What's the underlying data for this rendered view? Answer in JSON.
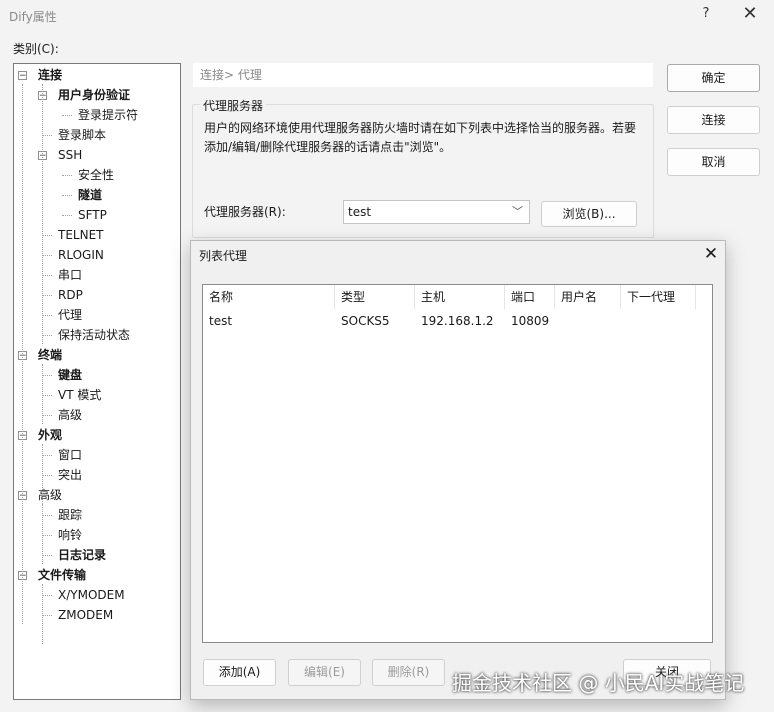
{
  "window": {
    "title": "Dify属性",
    "help_label": "?",
    "close_label": "✕"
  },
  "category_label": "类别(C):",
  "tree": [
    {
      "label": "连接",
      "bold": true,
      "toggle": "−"
    },
    {
      "label": "用户身份验证",
      "bold": true,
      "toggle": "−"
    },
    {
      "label": "登录提示符",
      "bold": false
    },
    {
      "label": "登录脚本",
      "bold": false
    },
    {
      "label": "SSH",
      "bold": false,
      "toggle": "−"
    },
    {
      "label": "安全性",
      "bold": false
    },
    {
      "label": "隧道",
      "bold": true
    },
    {
      "label": "SFTP",
      "bold": false
    },
    {
      "label": "TELNET",
      "bold": false
    },
    {
      "label": "RLOGIN",
      "bold": false
    },
    {
      "label": "串口",
      "bold": false
    },
    {
      "label": "RDP",
      "bold": false
    },
    {
      "label": "代理",
      "bold": false
    },
    {
      "label": "保持活动状态",
      "bold": false
    },
    {
      "label": "终端",
      "bold": true,
      "toggle": "−"
    },
    {
      "label": "键盘",
      "bold": true
    },
    {
      "label": "VT 模式",
      "bold": false
    },
    {
      "label": "高级",
      "bold": false
    },
    {
      "label": "外观",
      "bold": true,
      "toggle": "−"
    },
    {
      "label": "窗口",
      "bold": false
    },
    {
      "label": "突出",
      "bold": false
    },
    {
      "label": "高级",
      "bold": false,
      "toggle": "−"
    },
    {
      "label": "跟踪",
      "bold": false
    },
    {
      "label": "响铃",
      "bold": false
    },
    {
      "label": "日志记录",
      "bold": true
    },
    {
      "label": "文件传输",
      "bold": true,
      "toggle": "−"
    },
    {
      "label": "X/YMODEM",
      "bold": false
    },
    {
      "label": "ZMODEM",
      "bold": false
    }
  ],
  "breadcrumb": "连接> 代理",
  "proxy_group": {
    "title": "代理服务器",
    "description": "用户的网络环境使用代理服务器防火墙时请在如下列表中选择恰当的服务器。若要添加/编辑/删除代理服务器的话请点击\"浏览\"。",
    "server_label": "代理服务器(R):",
    "server_value": "test",
    "browse_button": "浏览(B)..."
  },
  "buttons": {
    "ok": "确定",
    "connect": "连接",
    "cancel": "取消"
  },
  "list_dialog": {
    "title": "列表代理",
    "close_label": "✕",
    "columns": [
      "名称",
      "类型",
      "主机",
      "端口",
      "用户名",
      "下一代理"
    ],
    "rows": [
      [
        "test",
        "SOCKS5",
        "192.168.1.2",
        "10809",
        "",
        ""
      ]
    ],
    "add_button": "添加(A)",
    "edit_button": "编辑(E)",
    "delete_button": "删除(R)",
    "close_button": "关闭"
  },
  "watermark": "掘金技术社区 @ 小民AI实战笔记"
}
